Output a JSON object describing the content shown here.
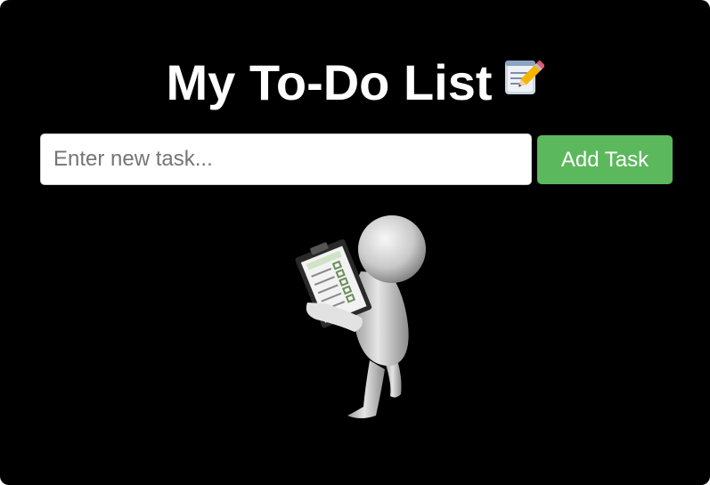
{
  "title": {
    "text": "My To-Do List",
    "emoji_icon": "memo-pencil-icon"
  },
  "task_input": {
    "placeholder": "Enter new task...",
    "value": ""
  },
  "add_button": {
    "label": "Add Task",
    "color": "#5cb85c"
  },
  "illustration": {
    "icon": "figure-with-checklist-icon"
  },
  "tasks": []
}
